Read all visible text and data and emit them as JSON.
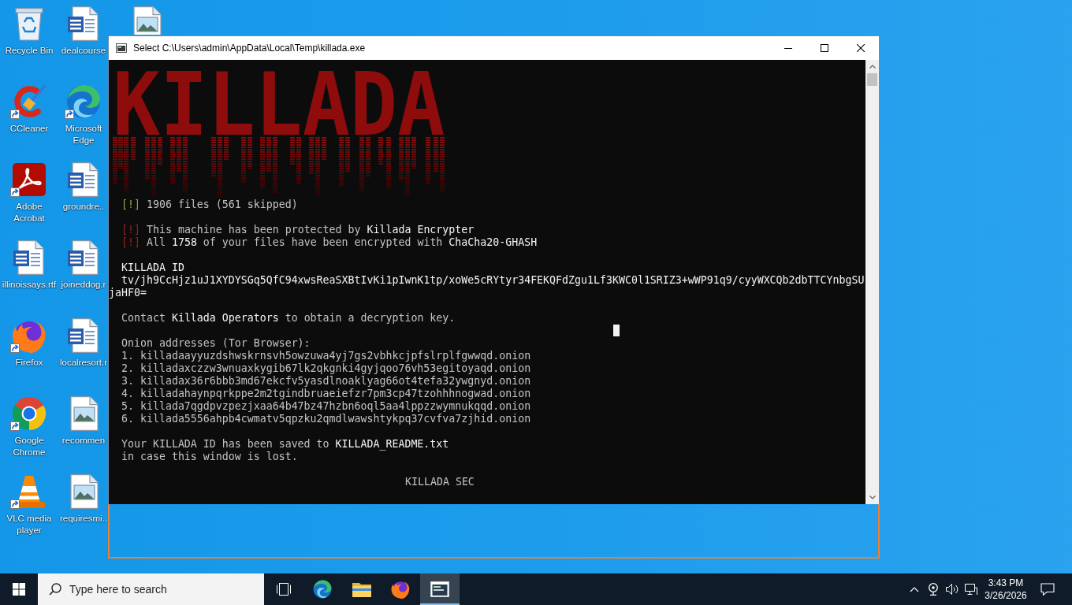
{
  "desktop": {
    "icons": [
      {
        "kind": "recycle-bin",
        "label": "Recycle Bin",
        "shortcut": false
      },
      {
        "kind": "ccleaner",
        "label": "CCleaner",
        "shortcut": true
      },
      {
        "kind": "acrobat",
        "label": "Adobe Acrobat",
        "shortcut": true
      },
      {
        "kind": "word-doc",
        "label": "illinoissays.rtf",
        "shortcut": false
      },
      {
        "kind": "firefox",
        "label": "Firefox",
        "shortcut": true
      },
      {
        "kind": "chrome",
        "label": "Google Chrome",
        "shortcut": true
      },
      {
        "kind": "vlc",
        "label": "VLC media player",
        "shortcut": true
      },
      {
        "kind": "word-doc",
        "label": "dealcourse",
        "shortcut": false
      },
      {
        "kind": "edge",
        "label": "Microsoft Edge",
        "shortcut": true
      },
      {
        "kind": "word-doc",
        "label": "groundre..",
        "shortcut": false
      },
      {
        "kind": "word-doc",
        "label": "joineddog.r",
        "shortcut": false
      },
      {
        "kind": "word-doc",
        "label": "localresort.r",
        "shortcut": false
      },
      {
        "kind": "image-file",
        "label": "recommen",
        "shortcut": false
      },
      {
        "kind": "image-file",
        "label": "requiresmi..",
        "shortcut": false
      },
      {
        "kind": "image-file"
      }
    ]
  },
  "window": {
    "title": "Select C:\\Users\\admin\\AppData\\Local\\Temp\\killada.exe"
  },
  "console": {
    "logo": "KILLADA",
    "notice_groups": [
      [
        {
          "kind": "info",
          "marker": "[!]",
          "text": "1906 files (561 skipped)"
        }
      ],
      [
        {
          "kind": "alert",
          "marker": "[!]",
          "text": "This machine has been protected by **Killada Encrypter**"
        },
        {
          "kind": "alert",
          "marker": "[!]",
          "text": "All **1758** of your files have been encrypted with **ChaCha20-GHASH**"
        }
      ]
    ],
    "id_label": "KILLADA ID",
    "id": "tv/jh9CcHjz1uJ1XYDYSGq5QfC94xwsReaSXBtIvKi1pIwnK1tp/xoWe5cRYtyr34FEKQFdZgu1Lf3KWC0l1SRIZ3+wWP91q9/cyyWXCQb2dbTTCYnbgSUjaHF0=",
    "contact": "Contact **Killada Operators** to obtain a decryption key.",
    "onion_heading": "Onion addresses (Tor Browser):",
    "onion_addresses": [
      "1. killadaayyuzdshwskrnsvh5owzuwa4yj7gs2vbhkcjpfslrplfgwwqd.onion",
      "2. killadaxczzw3wnuaxkygib67lk2qkgnki4gyjqoo76vh53egitoyaqd.onion",
      "3. killadax36r6bbb3md67ekcfv5yasdlnoaklyag66ot4tefa32ywgnyd.onion",
      "4. killadahaynpqrkppe2m2tgindbruaeiefzr7pm3cp47tzohhhnogwad.onion",
      "5. killada7qgdpvzpezjxaa64b47bz47hzbn6oql5aa4lppzzwymnukqqd.onion",
      "6. killada5556ahpb4cwmatv5qpzku2qmdlwawshtykpq37cvfva7zjhid.onion"
    ],
    "saved_note": "Your KILLADA ID has been saved to **KILLADA_README.txt**\nin case this window is lost.",
    "signature": "KILLADA SEC"
  },
  "taskbar": {
    "search": {
      "placeholder": "Type here to search"
    },
    "apps": [
      {
        "kind": "task-view",
        "selected": false
      },
      {
        "kind": "edge",
        "selected": false
      },
      {
        "kind": "file-explorer",
        "selected": false
      },
      {
        "kind": "firefox",
        "selected": false
      },
      {
        "kind": "console",
        "selected": true
      }
    ],
    "clock": {
      "time": "3:43 PM",
      "date": "3/26/2026"
    }
  }
}
